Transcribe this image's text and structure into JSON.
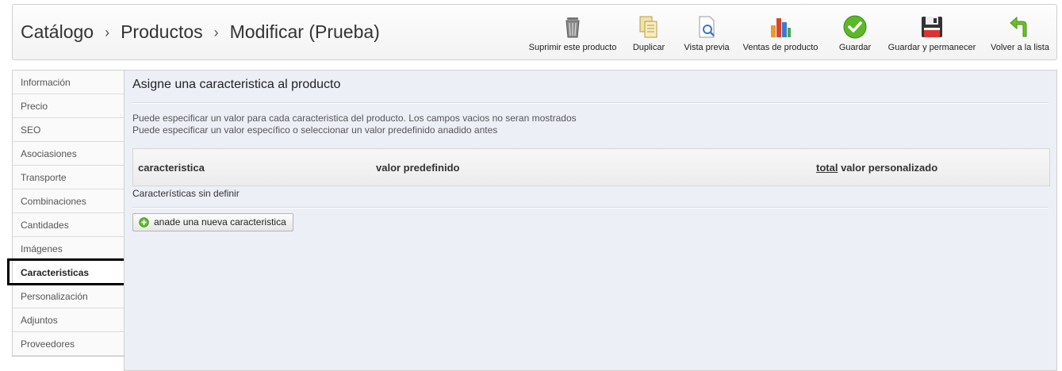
{
  "breadcrumb": {
    "items": [
      "Catálogo",
      "Productos",
      "Modificar (Prueba)"
    ],
    "separator": "›"
  },
  "toolbar": {
    "delete_label": "Suprimir este producto",
    "duplicate_label": "Duplicar",
    "preview_label": "Vista previa",
    "sales_label": "Ventas de producto",
    "save_label": "Guardar",
    "save_stay_label": "Guardar y permanecer",
    "back_label": "Volver a la lista"
  },
  "sidebar": {
    "items": [
      {
        "label": "Información"
      },
      {
        "label": "Precio"
      },
      {
        "label": "SEO"
      },
      {
        "label": "Asociasiones"
      },
      {
        "label": "Transporte"
      },
      {
        "label": "Combinaciones"
      },
      {
        "label": "Cantidades"
      },
      {
        "label": "Imágenes"
      },
      {
        "label": "Caracteristicas"
      },
      {
        "label": "Personalización"
      },
      {
        "label": "Adjuntos"
      },
      {
        "label": "Proveedores"
      }
    ],
    "active": "Caracteristicas"
  },
  "main": {
    "title": "Asigne una caracteristica al producto",
    "desc_line1": "Puede especificar un valor para cada caracteristica del producto. Los campos vacios no seran mostrados",
    "desc_line2": "Puede especificar un valor específico o seleccionar un valor predefinido anadido antes",
    "table": {
      "col_feature": "caracteristica",
      "col_predefined": "valor predefinido",
      "col_total": "total",
      "col_custom": "valor personalizado"
    },
    "empty_message": "Características sin definir",
    "add_button_label": "anade una nueva caracteristica"
  },
  "colors": {
    "panel_bg": "#eceff6",
    "save_green": "#5cb82a",
    "back_green": "#6cbf2a"
  }
}
